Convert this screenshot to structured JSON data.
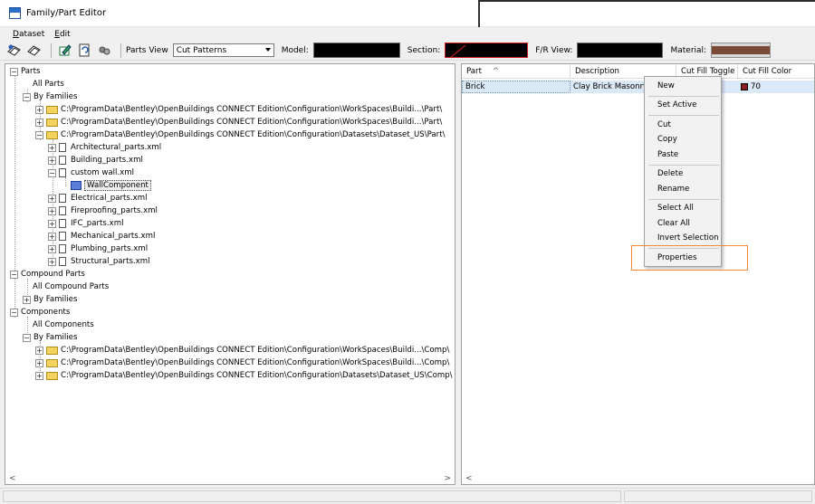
{
  "window": {
    "title": "Family/Part Editor"
  },
  "menu": [
    {
      "label": "Dataset"
    },
    {
      "label": "Edit"
    }
  ],
  "toolbar": {
    "parts_view_label": "Parts View",
    "parts_view_value": "Cut Patterns",
    "model_label": "Model:",
    "section_label": "Section:",
    "fr_view_label": "F/R View:",
    "material_label": "Material:"
  },
  "tree": {
    "parts": "Parts",
    "all_parts": "All Parts",
    "by_families": "By Families",
    "path_workspaces_part_1": "C:\\ProgramData\\Bentley\\OpenBuildings CONNECT Edition\\Configuration\\WorkSpaces\\Buildi...\\Part\\",
    "path_workspaces_part_2": "C:\\ProgramData\\Bentley\\OpenBuildings CONNECT Edition\\Configuration\\WorkSpaces\\Buildi...\\Part\\",
    "path_datasets_part": "C:\\ProgramData\\Bentley\\OpenBuildings CONNECT Edition\\Configuration\\Datasets\\Dataset_US\\Part\\",
    "files": [
      "Architectural_parts.xml",
      "Building_parts.xml",
      "custom wall.xml",
      "Electrical_parts.xml",
      "Fireproofing_parts.xml",
      "IFC_parts.xml",
      "Mechanical_parts.xml",
      "Plumbing_parts.xml",
      "Structural_parts.xml"
    ],
    "wall_component": "WallComponent",
    "compound_parts": "Compound Parts",
    "all_compound_parts": "All Compound Parts",
    "compound_by_families": "By Families",
    "components": "Components",
    "all_components": "All Components",
    "components_by_families": "By Families",
    "path_workspaces_comp_1": "C:\\ProgramData\\Bentley\\OpenBuildings CONNECT Edition\\Configuration\\WorkSpaces\\Buildi...\\Comp\\",
    "path_workspaces_comp_2": "C:\\ProgramData\\Bentley\\OpenBuildings CONNECT Edition\\Configuration\\WorkSpaces\\Buildi...\\Comp\\",
    "path_datasets_comp": "C:\\ProgramData\\Bentley\\OpenBuildings CONNECT Edition\\Configuration\\Datasets\\Dataset_US\\Comp\\"
  },
  "list": {
    "columns": [
      "Part",
      "Description",
      "Cut Fill Toggle",
      "Cut Fill Color"
    ],
    "sort_indicator": "^",
    "row": {
      "part": "Brick",
      "description": "Clay Brick Masonry",
      "cut_fill_color": "70",
      "color_hex": "#8a1f1f"
    }
  },
  "context_menu": {
    "new": "New",
    "set_active": "Set Active",
    "cut": "Cut",
    "copy": "Copy",
    "paste": "Paste",
    "delete": "Delete",
    "rename": "Rename",
    "select_all": "Select All",
    "clear_all": "Clear All",
    "invert_selection": "Invert Selection",
    "properties": "Properties"
  },
  "scroll": {
    "left": "<",
    "right": ">"
  },
  "highlight_color": "#f08a3a"
}
